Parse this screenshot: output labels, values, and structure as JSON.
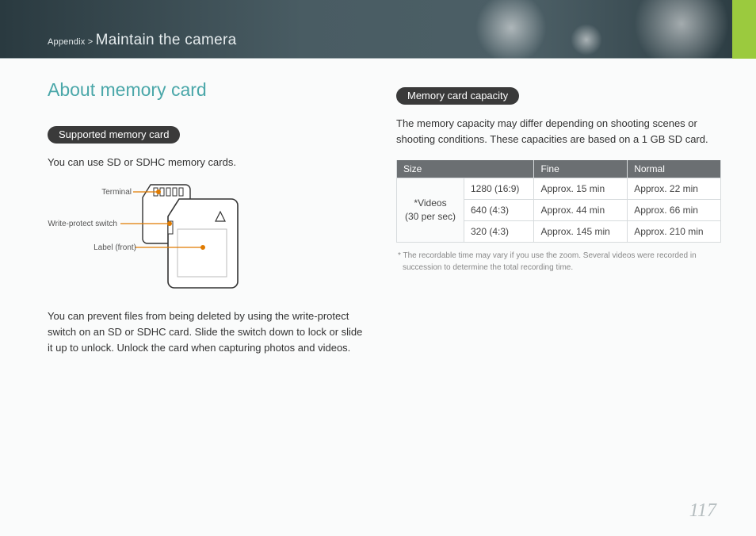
{
  "header": {
    "prefix": "Appendix >",
    "section": "Maintain the camera"
  },
  "title": "About memory card",
  "left": {
    "pill": "Supported memory card",
    "intro": "You can use SD or SDHC memory cards.",
    "labels": {
      "terminal": "Terminal",
      "wps": "Write-protect switch",
      "label_front": "Label (front)"
    },
    "para2": "You can prevent files from being deleted by using the write-protect switch on an SD or SDHC card. Slide the switch down to lock or slide it up to unlock. Unlock the card when capturing photos and videos."
  },
  "right": {
    "pill": "Memory card capacity",
    "intro": "The memory capacity may differ depending on shooting scenes or shooting conditions. These capacities are based on a 1 GB SD card.",
    "table": {
      "headers": {
        "size": "Size",
        "fine": "Fine",
        "normal": "Normal"
      },
      "rowhead_l1": "*Videos",
      "rowhead_l2": "(30 per sec)",
      "rows": [
        {
          "size": "1280 (16:9)",
          "fine": "Approx. 15 min",
          "normal": "Approx. 22 min"
        },
        {
          "size": "640 (4:3)",
          "fine": "Approx. 44 min",
          "normal": "Approx. 66 min"
        },
        {
          "size": "320 (4:3)",
          "fine": "Approx. 145 min",
          "normal": "Approx. 210 min"
        }
      ]
    },
    "footnote": "* The recordable time may vary if you use the zoom. Several videos were recorded in succession to determine the total recording time."
  },
  "page_number": "117"
}
